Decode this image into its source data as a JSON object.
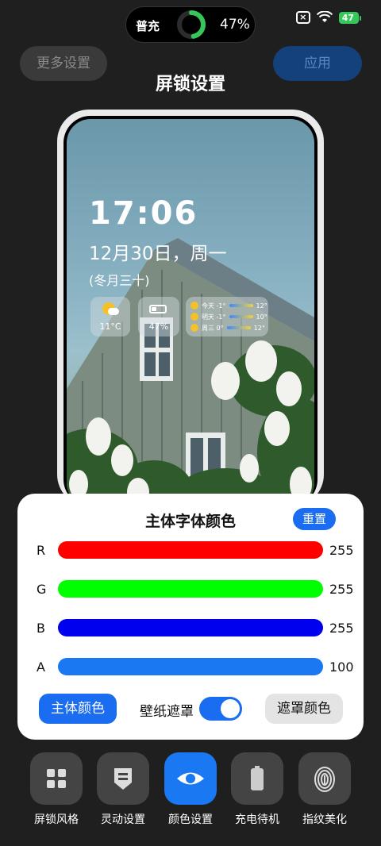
{
  "status_bar": {
    "charge_label": "普充",
    "charge_percent": "47%",
    "charge_level": 0.47,
    "battery_badge": "47"
  },
  "header": {
    "more_settings_label": "更多设置",
    "apply_label": "应用",
    "title": "屏锁设置"
  },
  "preview": {
    "time": "17:06",
    "date": "12月30日，周一",
    "lunar": "(冬月三十)",
    "weather_temp": "11°C",
    "battery_percent": "47%",
    "forecast": [
      {
        "day": "今天",
        "low": "-1°",
        "high": "12°"
      },
      {
        "day": "明天",
        "low": "-1°",
        "high": "10°"
      },
      {
        "day": "周三",
        "low": "0°",
        "high": "12°"
      }
    ]
  },
  "color_panel": {
    "title": "主体字体颜色",
    "reset_label": "重置",
    "sliders": [
      {
        "label": "R",
        "value": "255",
        "color": "#ff0000"
      },
      {
        "label": "G",
        "value": "255",
        "color": "#00ff00"
      },
      {
        "label": "B",
        "value": "255",
        "color": "#0000ee"
      },
      {
        "label": "A",
        "value": "100",
        "color": "#1a78f2"
      }
    ],
    "main_color_label": "主体颜色",
    "wallpaper_mask_label": "壁纸遮罩",
    "wallpaper_mask_on": true,
    "mask_color_label": "遮罩颜色"
  },
  "bottom_nav": [
    {
      "label": "屏锁风格",
      "icon": "grid-icon",
      "active": false
    },
    {
      "label": "灵动设置",
      "icon": "badge-icon",
      "active": false
    },
    {
      "label": "颜色设置",
      "icon": "eye-icon",
      "active": true
    },
    {
      "label": "充电待机",
      "icon": "battery-icon",
      "active": false
    },
    {
      "label": "指纹美化",
      "icon": "fingerprint-icon",
      "active": false
    }
  ],
  "colors": {
    "accent": "#1a6cf0",
    "background": "#1f1f1f"
  }
}
